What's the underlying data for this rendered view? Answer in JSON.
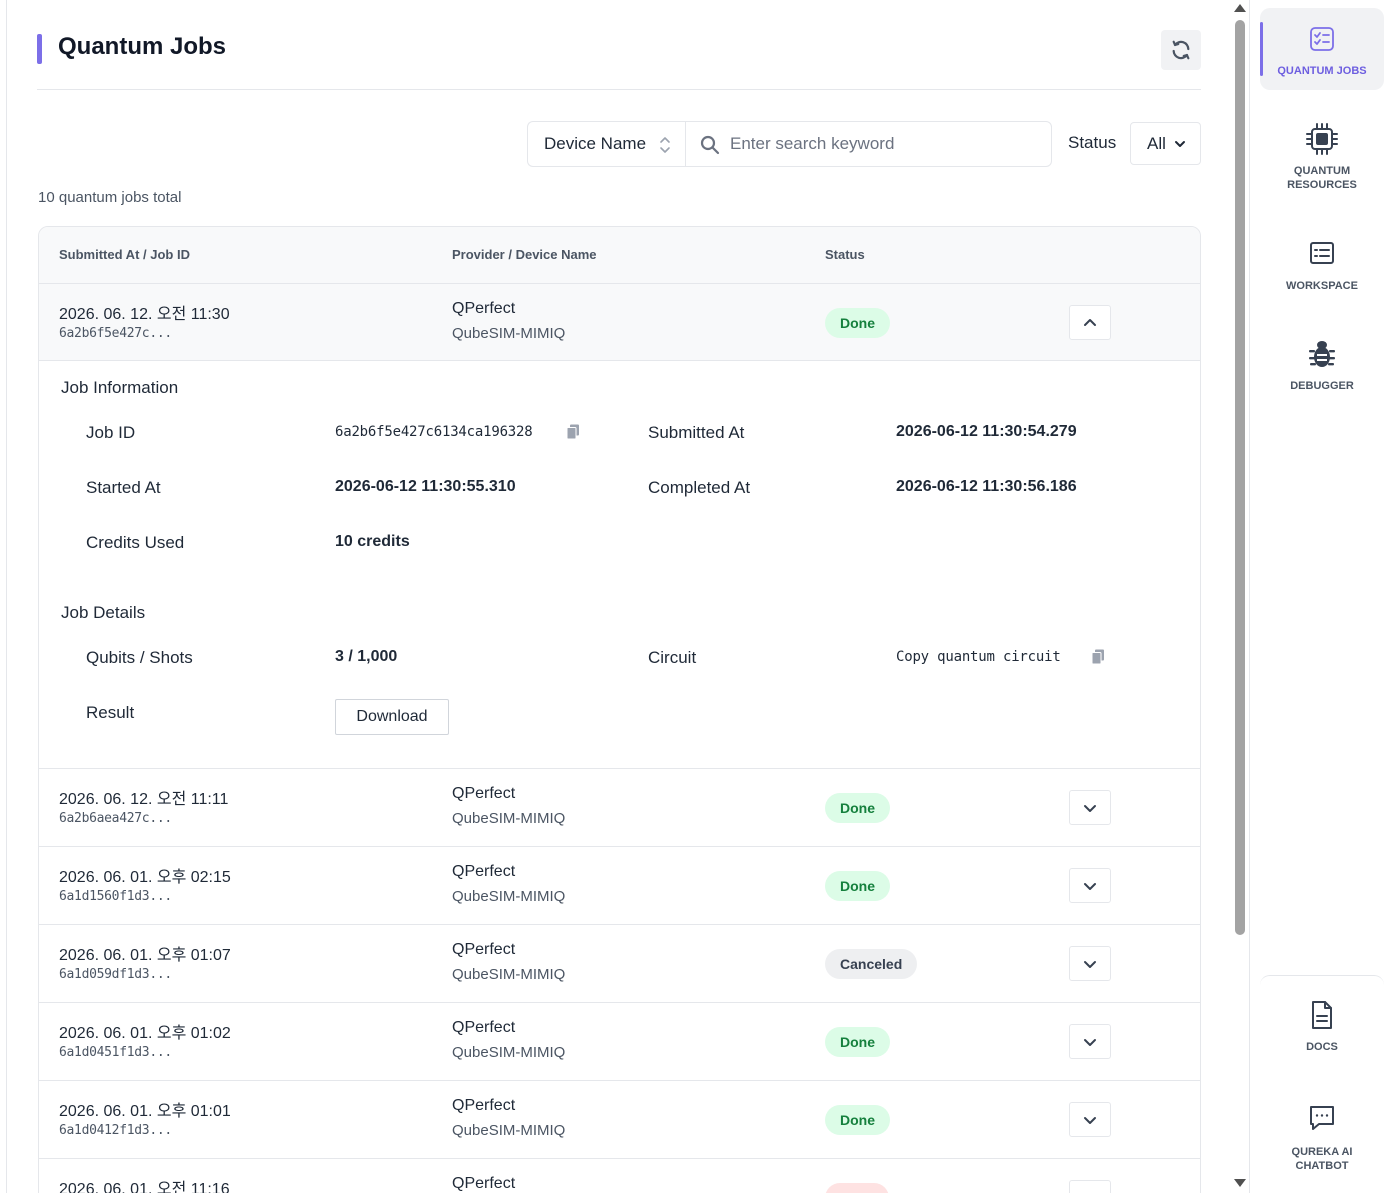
{
  "page": {
    "title": "Quantum Jobs",
    "total_text": "10 quantum jobs total"
  },
  "search": {
    "field_select": "Device Name",
    "placeholder": "Enter search keyword",
    "status_label": "Status",
    "status_value": "All"
  },
  "table": {
    "headers": [
      "Submitted At / Job ID",
      "Provider / Device Name",
      "Status"
    ],
    "rows": [
      {
        "date": "2026. 06. 12. 오전 11:30",
        "id": "6a2b6f5e427c...",
        "provider": "QPerfect",
        "device": "QubeSIM-MIMIQ",
        "status": "Done"
      },
      {
        "date": "2026. 06. 12. 오전 11:11",
        "id": "6a2b6aea427c...",
        "provider": "QPerfect",
        "device": "QubeSIM-MIMIQ",
        "status": "Done"
      },
      {
        "date": "2026. 06. 01. 오후 02:15",
        "id": "6a1d1560f1d3...",
        "provider": "QPerfect",
        "device": "QubeSIM-MIMIQ",
        "status": "Done"
      },
      {
        "date": "2026. 06. 01. 오후 01:07",
        "id": "6a1d059df1d3...",
        "provider": "QPerfect",
        "device": "QubeSIM-MIMIQ",
        "status": "Canceled"
      },
      {
        "date": "2026. 06. 01. 오후 01:02",
        "id": "6a1d0451f1d3...",
        "provider": "QPerfect",
        "device": "QubeSIM-MIMIQ",
        "status": "Done"
      },
      {
        "date": "2026. 06. 01. 오후 01:01",
        "id": "6a1d0412f1d3...",
        "provider": "QPerfect",
        "device": "QubeSIM-MIMIQ",
        "status": "Done"
      },
      {
        "date": "2026. 06. 01. 오전 11:16",
        "id": "",
        "provider": "QPerfect",
        "device": "",
        "status": ""
      }
    ]
  },
  "detail": {
    "job_info_title": "Job Information",
    "job_id_label": "Job ID",
    "job_id_value": "6a2b6f5e427c6134ca196328",
    "submitted_label": "Submitted At",
    "submitted_value": "2026-06-12 11:30:54.279",
    "started_label": "Started At",
    "started_value": "2026-06-12 11:30:55.310",
    "completed_label": "Completed At",
    "completed_value": "2026-06-12 11:30:56.186",
    "credits_label": "Credits Used",
    "credits_value": "10 credits",
    "job_details_title": "Job Details",
    "qubits_label": "Qubits / Shots",
    "qubits_value": "3 / 1,000",
    "circuit_label": "Circuit",
    "circuit_value": "Copy quantum circuit",
    "result_label": "Result",
    "download_label": "Download"
  },
  "sidebar": {
    "items": [
      {
        "label": "QUANTUM JOBS",
        "icon": "checklist-icon"
      },
      {
        "label_1": "QUANTUM",
        "label_2": "RESOURCES",
        "icon": "chip-icon"
      },
      {
        "label": "WORKSPACE",
        "icon": "workspace-icon"
      },
      {
        "label": "DEBUGGER",
        "icon": "bug-icon"
      },
      {
        "label": "DOCS",
        "icon": "document-icon"
      },
      {
        "label_1": "QUREKA AI",
        "label_2": "CHATBOT",
        "icon": "chat-icon"
      }
    ]
  },
  "colors": {
    "accent": "#7c6fe8",
    "done_bg": "#dcfce7",
    "done_text": "#15803d",
    "canceled_bg": "#eeeff1"
  }
}
